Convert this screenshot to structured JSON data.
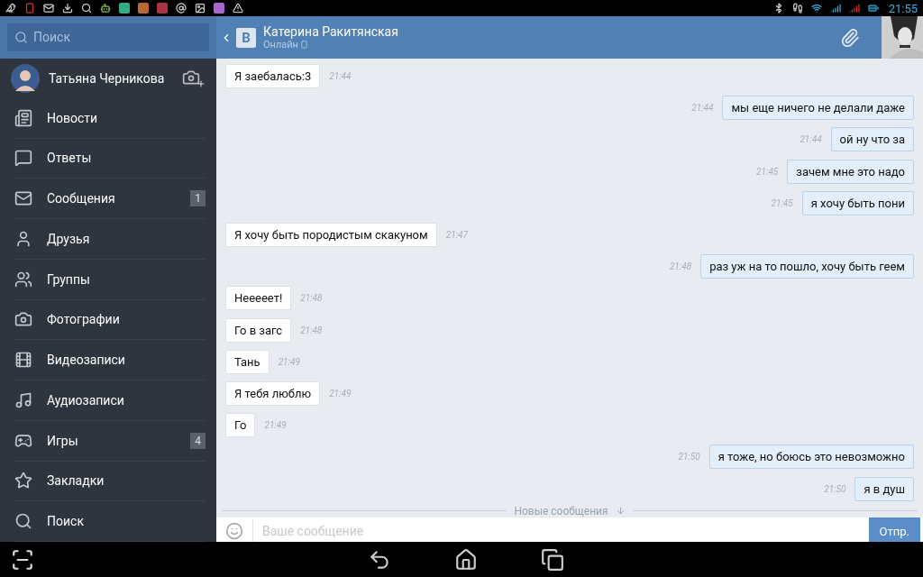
{
  "status_bar": {
    "time": "21:55"
  },
  "sidebar": {
    "search": {
      "placeholder": "Поиск"
    },
    "profile": {
      "name": "Татьяна Черникова"
    },
    "items": [
      {
        "kind": "news",
        "label": "Новости"
      },
      {
        "kind": "replies",
        "label": "Ответы"
      },
      {
        "kind": "messages",
        "label": "Сообщения",
        "badge": "1"
      },
      {
        "kind": "friends",
        "label": "Друзья"
      },
      {
        "kind": "groups",
        "label": "Группы"
      },
      {
        "kind": "photos",
        "label": "Фотографии"
      },
      {
        "kind": "videos",
        "label": "Видеозаписи"
      },
      {
        "kind": "audio",
        "label": "Аудиозаписи"
      },
      {
        "kind": "games",
        "label": "Игры",
        "badge": "4"
      },
      {
        "kind": "bookmarks",
        "label": "Закладки"
      },
      {
        "kind": "search",
        "label": "Поиск"
      }
    ]
  },
  "chat": {
    "logo": "B",
    "contact": {
      "name": "Катерина Ракитянская",
      "status": "Онлайн"
    },
    "messages": [
      {
        "text": "Я заебалась:3",
        "time": "21:44",
        "outgoing": false
      },
      {
        "text": "мы еще ничего не делали даже",
        "time": "21:44",
        "outgoing": true
      },
      {
        "text": "ой ну что за",
        "time": "21:44",
        "outgoing": true
      },
      {
        "text": "зачем мне это надо",
        "time": "21:45",
        "outgoing": true
      },
      {
        "text": "я хочу быть пони",
        "time": "21:45",
        "outgoing": true
      },
      {
        "text": "Я хочу быть породистым скакуном",
        "time": "21:47",
        "outgoing": false
      },
      {
        "text": "раз уж на то пошло, хочу быть геем",
        "time": "21:48",
        "outgoing": true
      },
      {
        "text": "Нееееет!",
        "time": "21:48",
        "outgoing": false
      },
      {
        "text": "Го в загс",
        "time": "21:48",
        "outgoing": false
      },
      {
        "text": "Тань",
        "time": "21:49",
        "outgoing": false
      },
      {
        "text": "Я тебя люблю",
        "time": "21:49",
        "outgoing": false
      },
      {
        "text": "Го",
        "time": "21:49",
        "outgoing": false
      },
      {
        "text": "я тоже, но боюсь это невозможно",
        "time": "21:50",
        "outgoing": true
      },
      {
        "text": "я в душ",
        "time": "21:50",
        "outgoing": true
      }
    ],
    "new_messages_divider": "Новые сообщения",
    "composer": {
      "placeholder": "Ваше сообщение",
      "send": "Отпр."
    }
  }
}
